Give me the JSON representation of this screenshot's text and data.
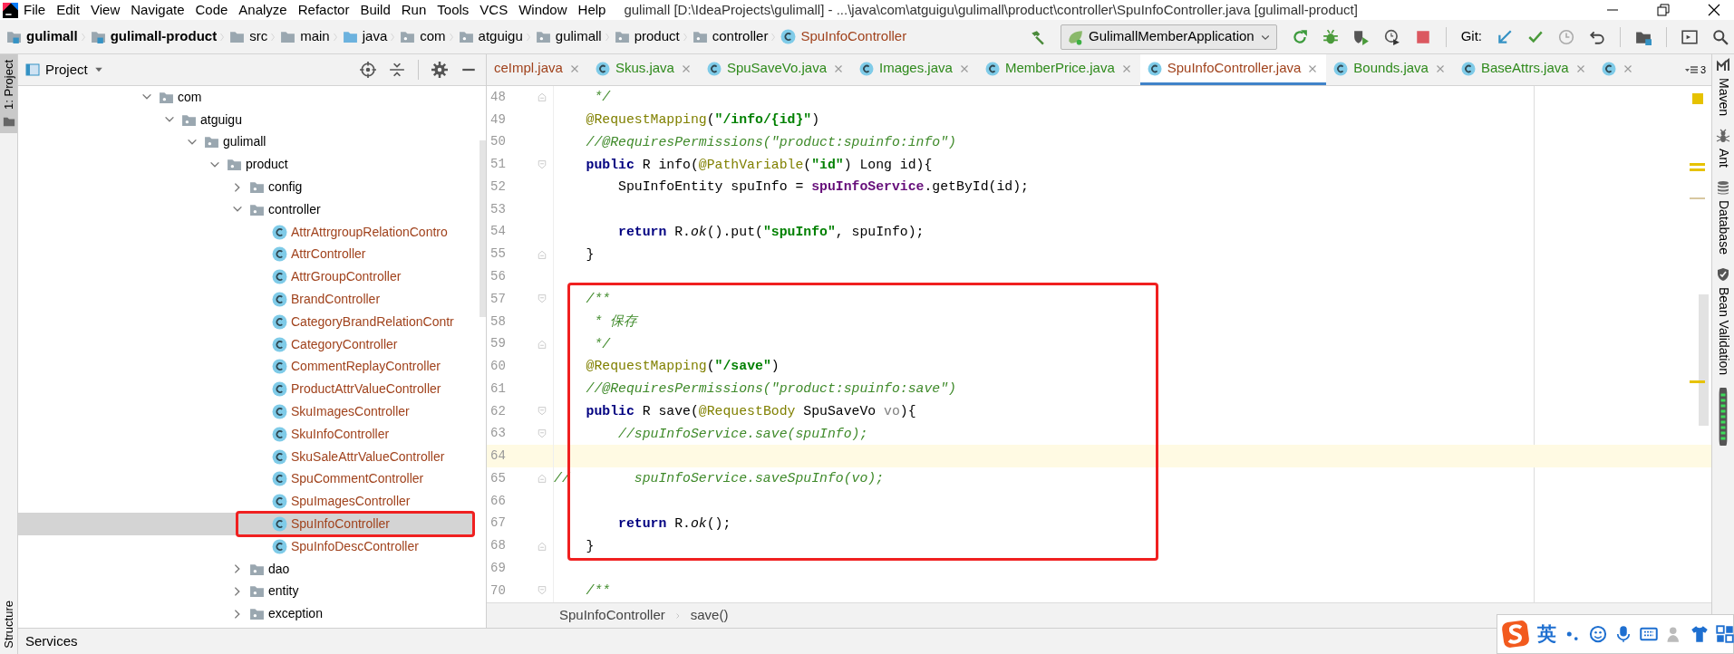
{
  "menu_bar": {
    "items": [
      "File",
      "Edit",
      "View",
      "Navigate",
      "Code",
      "Analyze",
      "Refactor",
      "Build",
      "Run",
      "Tools",
      "VCS",
      "Window",
      "Help"
    ],
    "title": "gulimall [D:\\IdeaProjects\\gulimall] - ...\\java\\com\\atguigu\\gulimall\\product\\controller\\SpuInfoController.java [gulimall-product]"
  },
  "navigation_bar": {
    "crumbs": [
      {
        "label": "gulimall",
        "kind": "module"
      },
      {
        "label": "gulimall-product",
        "kind": "module"
      },
      {
        "label": "src",
        "kind": "folder"
      },
      {
        "label": "main",
        "kind": "folder"
      },
      {
        "label": "java",
        "kind": "source"
      },
      {
        "label": "com",
        "kind": "package"
      },
      {
        "label": "atguigu",
        "kind": "package"
      },
      {
        "label": "gulimall",
        "kind": "package"
      },
      {
        "label": "product",
        "kind": "package"
      },
      {
        "label": "controller",
        "kind": "package"
      },
      {
        "label": "SpuInfoController",
        "kind": "class"
      }
    ],
    "run_configuration": "GulimallMemberApplication",
    "git_label": "Git:"
  },
  "left_tool_windows": [
    {
      "label": "1: Project",
      "selected": true
    },
    {
      "label": "Structure",
      "selected": false
    }
  ],
  "project_panel": {
    "title": "Project",
    "tree": [
      {
        "label": "com",
        "kind": "package",
        "expanded": true,
        "children": [
          {
            "label": "atguigu",
            "kind": "package",
            "expanded": true,
            "children": [
              {
                "label": "gulimall",
                "kind": "package",
                "expanded": true,
                "children": [
                  {
                    "label": "product",
                    "kind": "package",
                    "expanded": true,
                    "children": [
                      {
                        "label": "config",
                        "kind": "package",
                        "expanded": false
                      },
                      {
                        "label": "controller",
                        "kind": "package",
                        "expanded": true,
                        "children": [
                          {
                            "label": "AttrAttrgroupRelationContro",
                            "kind": "class",
                            "selected": false,
                            "annotated": false
                          },
                          {
                            "label": "AttrController",
                            "kind": "class",
                            "selected": false,
                            "annotated": false
                          },
                          {
                            "label": "AttrGroupController",
                            "kind": "class",
                            "selected": false,
                            "annotated": false
                          },
                          {
                            "label": "BrandController",
                            "kind": "class",
                            "selected": false,
                            "annotated": false
                          },
                          {
                            "label": "CategoryBrandRelationContr",
                            "kind": "class",
                            "selected": false,
                            "annotated": false
                          },
                          {
                            "label": "CategoryController",
                            "kind": "class",
                            "selected": false,
                            "annotated": false
                          },
                          {
                            "label": "CommentReplayController",
                            "kind": "class",
                            "selected": false,
                            "annotated": false
                          },
                          {
                            "label": "ProductAttrValueController",
                            "kind": "class",
                            "selected": false,
                            "annotated": false
                          },
                          {
                            "label": "SkuImagesController",
                            "kind": "class",
                            "selected": false,
                            "annotated": false
                          },
                          {
                            "label": "SkuInfoController",
                            "kind": "class",
                            "selected": false,
                            "annotated": false
                          },
                          {
                            "label": "SkuSaleAttrValueController",
                            "kind": "class",
                            "selected": false,
                            "annotated": false
                          },
                          {
                            "label": "SpuCommentController",
                            "kind": "class",
                            "selected": false,
                            "annotated": false
                          },
                          {
                            "label": "SpuImagesController",
                            "kind": "class",
                            "selected": false,
                            "annotated": false
                          },
                          {
                            "label": "SpuInfoController",
                            "kind": "class",
                            "selected": true,
                            "annotated": true
                          },
                          {
                            "label": "SpuInfoDescController",
                            "kind": "class",
                            "selected": false,
                            "annotated": false
                          }
                        ]
                      },
                      {
                        "label": "dao",
                        "kind": "package",
                        "expanded": false
                      },
                      {
                        "label": "entity",
                        "kind": "package",
                        "expanded": false
                      },
                      {
                        "label": "exception",
                        "kind": "package",
                        "expanded": false
                      }
                    ]
                  }
                ]
              }
            ]
          }
        ]
      }
    ]
  },
  "editor": {
    "tabs": [
      {
        "label": "ceImpl.java",
        "kind": "cut",
        "color": "#a0421c",
        "selected": false
      },
      {
        "label": "Skus.java",
        "kind": "file",
        "color": "#2f8a1c",
        "selected": false
      },
      {
        "label": "SpuSaveVo.java",
        "kind": "file",
        "color": "#2f8a1c",
        "selected": false
      },
      {
        "label": "Images.java",
        "kind": "file",
        "color": "#2f8a1c",
        "selected": false
      },
      {
        "label": "MemberPrice.java",
        "kind": "file",
        "color": "#2f8a1c",
        "selected": false
      },
      {
        "label": "SpuInfoController.java",
        "kind": "file",
        "color": "#a0421c",
        "selected": true
      },
      {
        "label": "Bounds.java",
        "kind": "file",
        "color": "#2f8a1c",
        "selected": false
      },
      {
        "label": "BaseAttrs.java",
        "kind": "file",
        "color": "#2f8a1c",
        "selected": false
      },
      {
        "kind": "icon-only",
        "selected": false
      }
    ],
    "overflow_count": "3",
    "blocks": [
      {
        "boxed": false,
        "lines": [
          {
            "number": "48",
            "fold": {
              "kind": "end"
            },
            "current": false,
            "segments": [
              {
                "kind": "comment",
                "text": "     */"
              }
            ]
          },
          {
            "number": "49",
            "current": false,
            "segments": [
              {
                "kind": "annotation",
                "text": "    @RequestMapping"
              },
              {
                "kind": "plain",
                "text": "("
              },
              {
                "kind": "string",
                "text": "\"/info/{id}\""
              },
              {
                "kind": "plain",
                "text": ")"
              }
            ]
          },
          {
            "number": "50",
            "current": false,
            "segments": [
              {
                "kind": "comment",
                "text": "    //@RequiresPermissions(\"product:spuinfo:info\")"
              }
            ]
          },
          {
            "number": "51",
            "fold": {
              "kind": "start"
            },
            "current": false,
            "segments": [
              {
                "kind": "keyword",
                "text": "    public"
              },
              {
                "kind": "plain",
                "text": " R info("
              },
              {
                "kind": "annotation",
                "text": "@PathVariable"
              },
              {
                "kind": "plain",
                "text": "("
              },
              {
                "kind": "string",
                "text": "\"id\""
              },
              {
                "kind": "plain",
                "text": ") Long id){"
              }
            ]
          },
          {
            "number": "52",
            "current": false,
            "segments": [
              {
                "kind": "plain",
                "text": "        SpuInfoEntity spuInfo = "
              },
              {
                "kind": "field",
                "text": "spuInfoService"
              },
              {
                "kind": "plain",
                "text": ".getById(id);"
              }
            ]
          },
          {
            "number": "53",
            "current": false
          },
          {
            "number": "54",
            "current": false,
            "segments": [
              {
                "kind": "keyword",
                "text": "        return"
              },
              {
                "kind": "plain",
                "text": " R."
              },
              {
                "kind": "static",
                "text": "ok"
              },
              {
                "kind": "plain",
                "text": "().put("
              },
              {
                "kind": "string",
                "text": "\"spuInfo\""
              },
              {
                "kind": "plain",
                "text": ", spuInfo);"
              }
            ]
          },
          {
            "number": "55",
            "fold": {
              "kind": "end"
            },
            "current": false,
            "segments": [
              {
                "kind": "plain",
                "text": "    }"
              }
            ]
          },
          {
            "number": "56",
            "current": false
          }
        ]
      },
      {
        "boxed": true,
        "lines": [
          {
            "number": "57",
            "fold": {
              "kind": "start"
            },
            "current": false,
            "segments": [
              {
                "kind": "comment",
                "text": "    /**"
              }
            ]
          },
          {
            "number": "58",
            "current": false,
            "segments": [
              {
                "kind": "comment",
                "text": "     * 保存"
              }
            ]
          },
          {
            "number": "59",
            "fold": {
              "kind": "end"
            },
            "current": false,
            "segments": [
              {
                "kind": "comment",
                "text": "     */"
              }
            ]
          },
          {
            "number": "60",
            "current": false,
            "segments": [
              {
                "kind": "annotation",
                "text": "    @RequestMapping"
              },
              {
                "kind": "plain",
                "text": "("
              },
              {
                "kind": "string",
                "text": "\"/save\""
              },
              {
                "kind": "plain",
                "text": ")"
              }
            ]
          },
          {
            "number": "61",
            "current": false,
            "segments": [
              {
                "kind": "comment",
                "text": "    //@RequiresPermissions(\"product:spuinfo:save\")"
              }
            ]
          },
          {
            "number": "62",
            "fold": {
              "kind": "start"
            },
            "current": false,
            "segments": [
              {
                "kind": "keyword",
                "text": "    public"
              },
              {
                "kind": "plain",
                "text": " R save("
              },
              {
                "kind": "annotation",
                "text": "@RequestBody"
              },
              {
                "kind": "plain",
                "text": " SpuSaveVo "
              },
              {
                "kind": "unused",
                "text": "vo"
              },
              {
                "kind": "plain",
                "text": "){"
              }
            ]
          },
          {
            "number": "63",
            "fold": {
              "kind": "start"
            },
            "current": false,
            "segments": [
              {
                "kind": "comment",
                "text": "        //spuInfoService.save(spuInfo);"
              }
            ]
          },
          {
            "number": "64",
            "current": true
          },
          {
            "number": "65",
            "fold": {
              "kind": "end"
            },
            "current": false,
            "segments": [
              {
                "kind": "comment",
                "text": "//        spuInfoService.saveSpuInfo(vo);"
              }
            ]
          },
          {
            "number": "66",
            "current": false
          },
          {
            "number": "67",
            "current": false,
            "segments": [
              {
                "kind": "keyword",
                "text": "        return"
              },
              {
                "kind": "plain",
                "text": " R."
              },
              {
                "kind": "static",
                "text": "ok"
              },
              {
                "kind": "plain",
                "text": "();"
              }
            ]
          },
          {
            "number": "68",
            "fold": {
              "kind": "end"
            },
            "current": false,
            "segments": [
              {
                "kind": "plain",
                "text": "    }"
              }
            ]
          }
        ]
      },
      {
        "boxed": false,
        "lines": [
          {
            "number": "69",
            "current": false
          },
          {
            "number": "70",
            "fold": {
              "kind": "start"
            },
            "current": false,
            "segments": [
              {
                "kind": "comment",
                "text": "    /**"
              }
            ]
          }
        ]
      }
    ],
    "breadcrumb": [
      "SpuInfoController",
      "save()"
    ]
  },
  "right_tool_windows": [
    {
      "label": "Maven",
      "kind": "maven"
    },
    {
      "label": "Ant",
      "kind": "ant"
    },
    {
      "label": "Database",
      "kind": "database"
    },
    {
      "label": "Bean Validation",
      "kind": "bean"
    }
  ],
  "bottom_bar": {
    "label": "Services"
  },
  "ime_toolbar": {
    "mode": "英"
  }
}
